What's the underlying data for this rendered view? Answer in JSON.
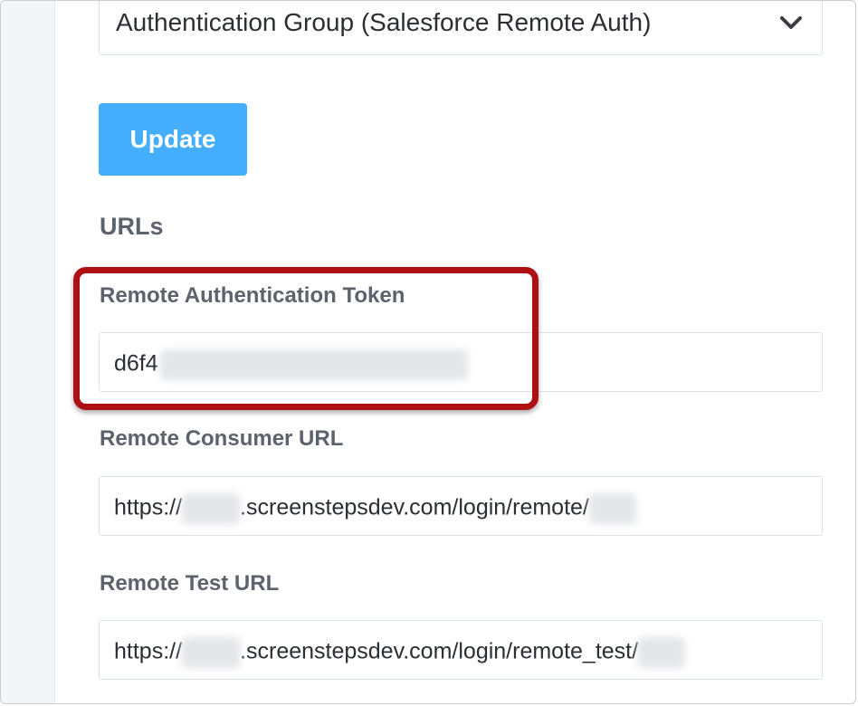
{
  "auth_group_select": {
    "value": "Authentication Group (Salesforce Remote Auth)"
  },
  "update_button": {
    "label": "Update"
  },
  "urls_section": {
    "title": "URLs"
  },
  "fields": {
    "token": {
      "label": "Remote Authentication Token",
      "value_visible": "d6f4"
    },
    "consumer_url": {
      "label": "Remote Consumer URL",
      "prefix": "https://",
      "middle": ".screenstepsdev.com/login/remote/"
    },
    "test_url": {
      "label": "Remote Test URL",
      "prefix": "https://",
      "middle": ".screenstepsdev.com/login/remote_test/"
    }
  },
  "colors": {
    "button": "#44aefc",
    "highlight": "#ad0f12",
    "label": "#5d636d"
  }
}
